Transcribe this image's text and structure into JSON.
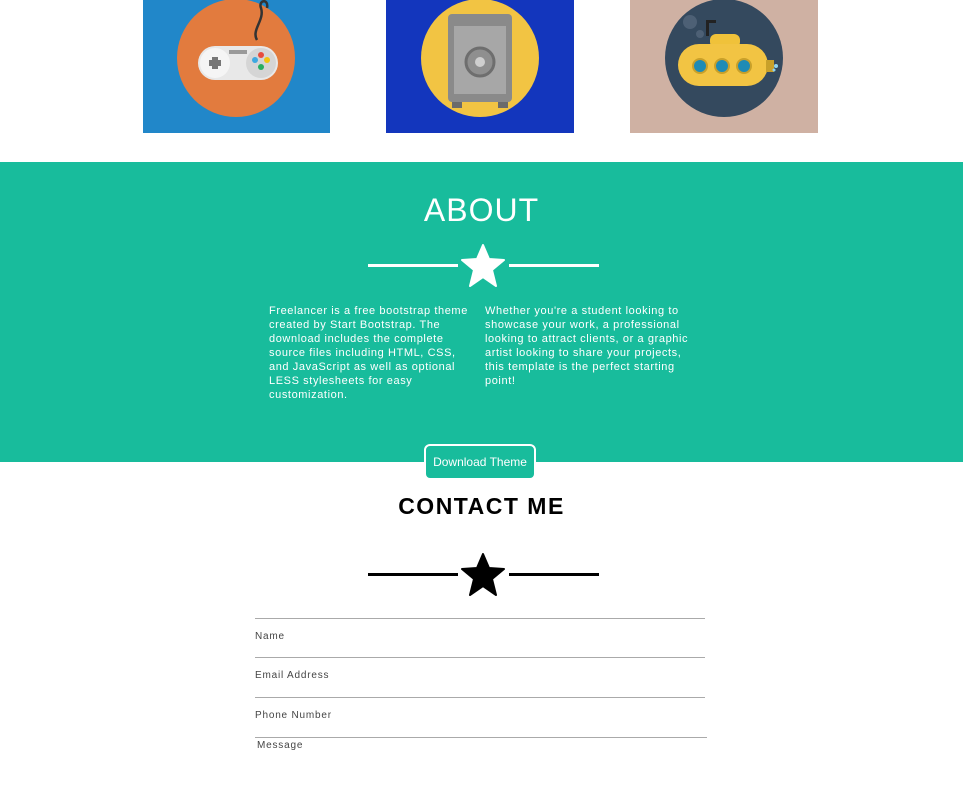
{
  "portfolio": {
    "tiles": [
      {
        "icon": "game-controller-icon",
        "bg": "#2187c9",
        "circle": "#e27b3e"
      },
      {
        "icon": "safe-icon",
        "bg": "#1336bd",
        "circle": "#f2c443"
      },
      {
        "icon": "submarine-icon",
        "bg": "#cfb1a3",
        "circle": "#34495e"
      }
    ]
  },
  "about": {
    "title": "ABOUT",
    "bg_color": "#18bc9c",
    "col1": "Freelancer is a free bootstrap theme created by Start Bootstrap. The download includes the complete source files including HTML, CSS, and JavaScript as well as optional LESS stylesheets for easy customization.",
    "col2": "Whether you're a student looking to showcase your work, a professional looking to attract clients, or a graphic artist looking to share your projects, this template is the perfect starting point!",
    "button_label": "Download Theme"
  },
  "contact": {
    "title": "CONTACT ME",
    "name_placeholder": "Name",
    "email_placeholder": "Email Address",
    "phone_placeholder": "Phone Number",
    "message_placeholder": "Message"
  },
  "colors": {
    "accent": "#18bc9c",
    "text_dark": "#000000",
    "text_light": "#ffffff"
  }
}
